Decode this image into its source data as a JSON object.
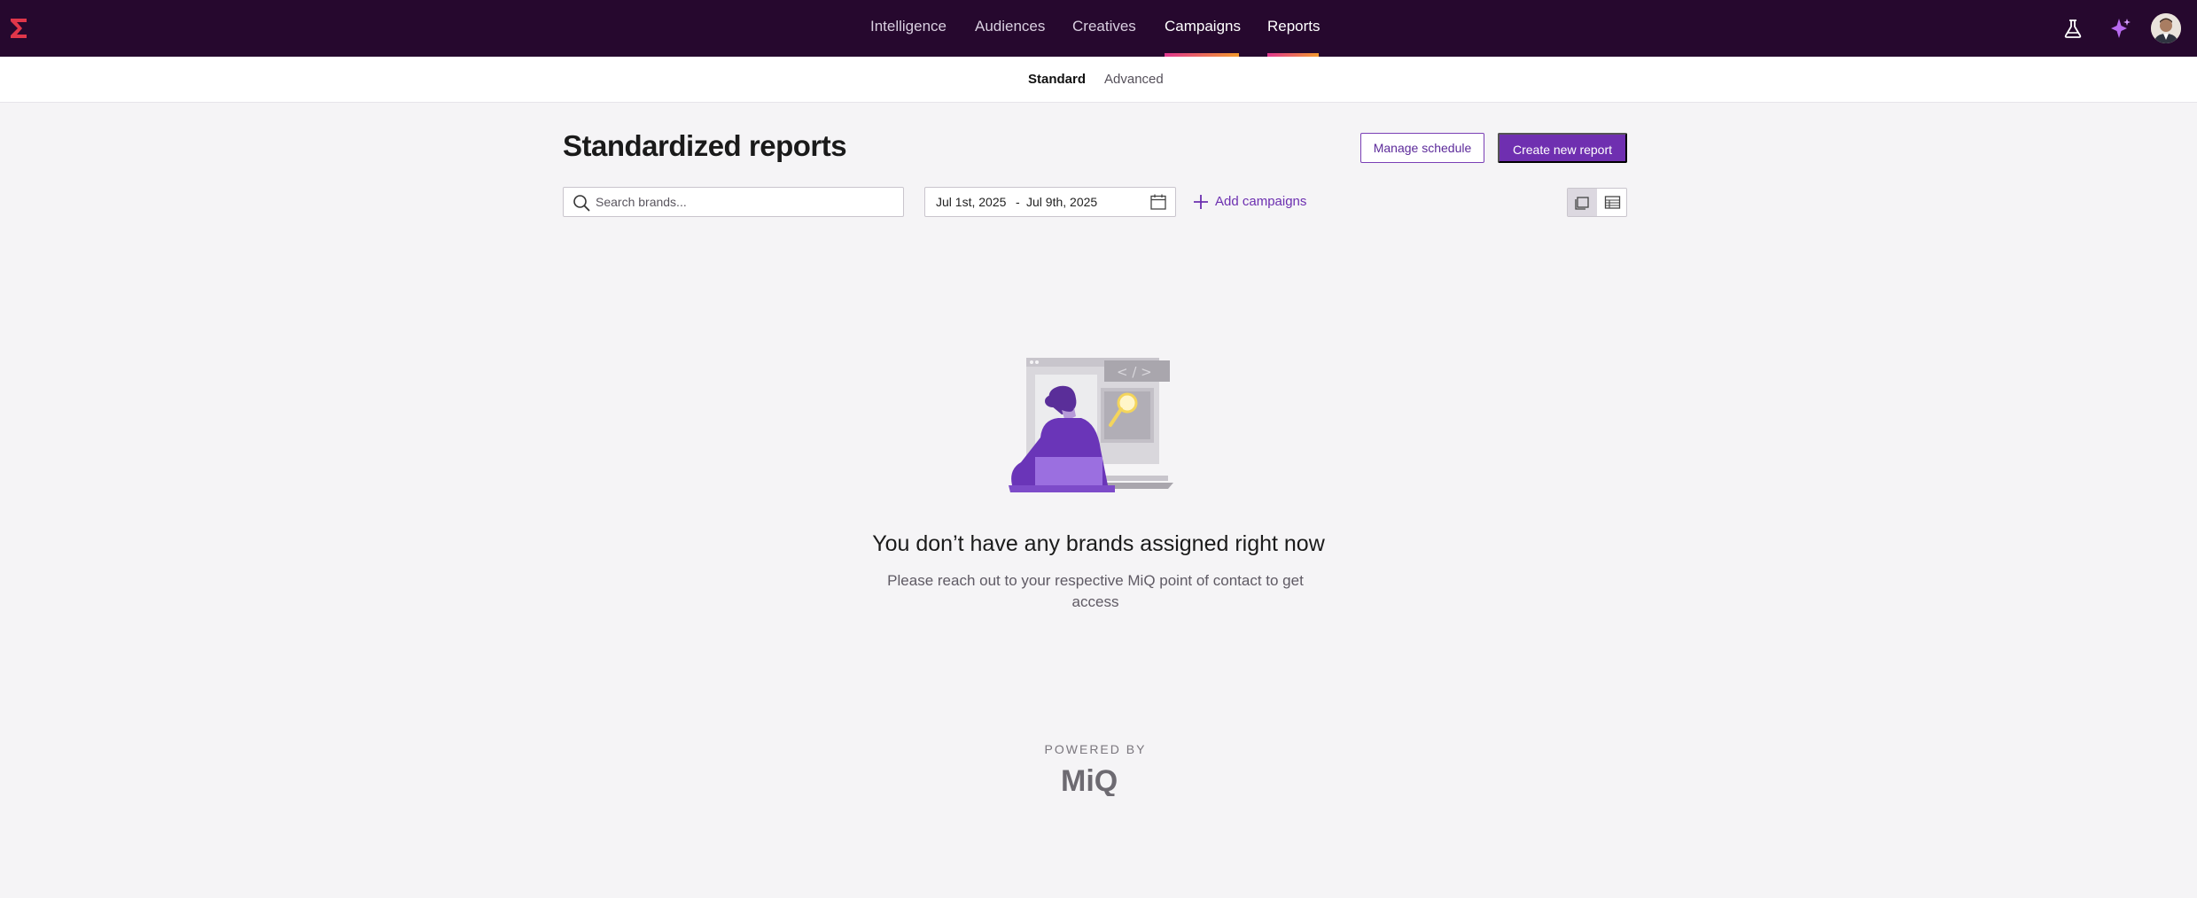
{
  "nav": {
    "items": [
      {
        "label": "Intelligence",
        "active": false
      },
      {
        "label": "Audiences",
        "active": false
      },
      {
        "label": "Creatives",
        "active": false
      },
      {
        "label": "Campaigns",
        "active": true
      },
      {
        "label": "Reports",
        "active": true
      }
    ],
    "right_icons": [
      "flask-icon",
      "sparkle-ai-icon"
    ],
    "avatar": "user-avatar"
  },
  "subnav": {
    "tabs": [
      {
        "label": "Standard",
        "active": true
      },
      {
        "label": "Advanced",
        "active": false
      }
    ]
  },
  "page": {
    "title": "Standardized reports",
    "manage_schedule_label": "Manage schedule",
    "create_report_label": "Create new report"
  },
  "filters": {
    "search_placeholder": "Search brands...",
    "date_start": "Jul 1st, 2025",
    "date_separator": "-",
    "date_end": "Jul 9th, 2025",
    "add_campaigns_label": "Add campaigns",
    "view_modes": [
      "card-view-icon",
      "table-view-icon"
    ],
    "active_view": "card-view-icon"
  },
  "empty_state": {
    "title": "You don’t have any brands assigned right now",
    "message": "Please reach out to your respective MiQ point of contact to get access"
  },
  "footer": {
    "powered_by": "POWERED BY",
    "brand": "MiQ"
  },
  "colors": {
    "nav_bg": "#26082e",
    "accent": "#6f2fb0",
    "underline_start": "#e0368f",
    "underline_end": "#f39a2c"
  }
}
